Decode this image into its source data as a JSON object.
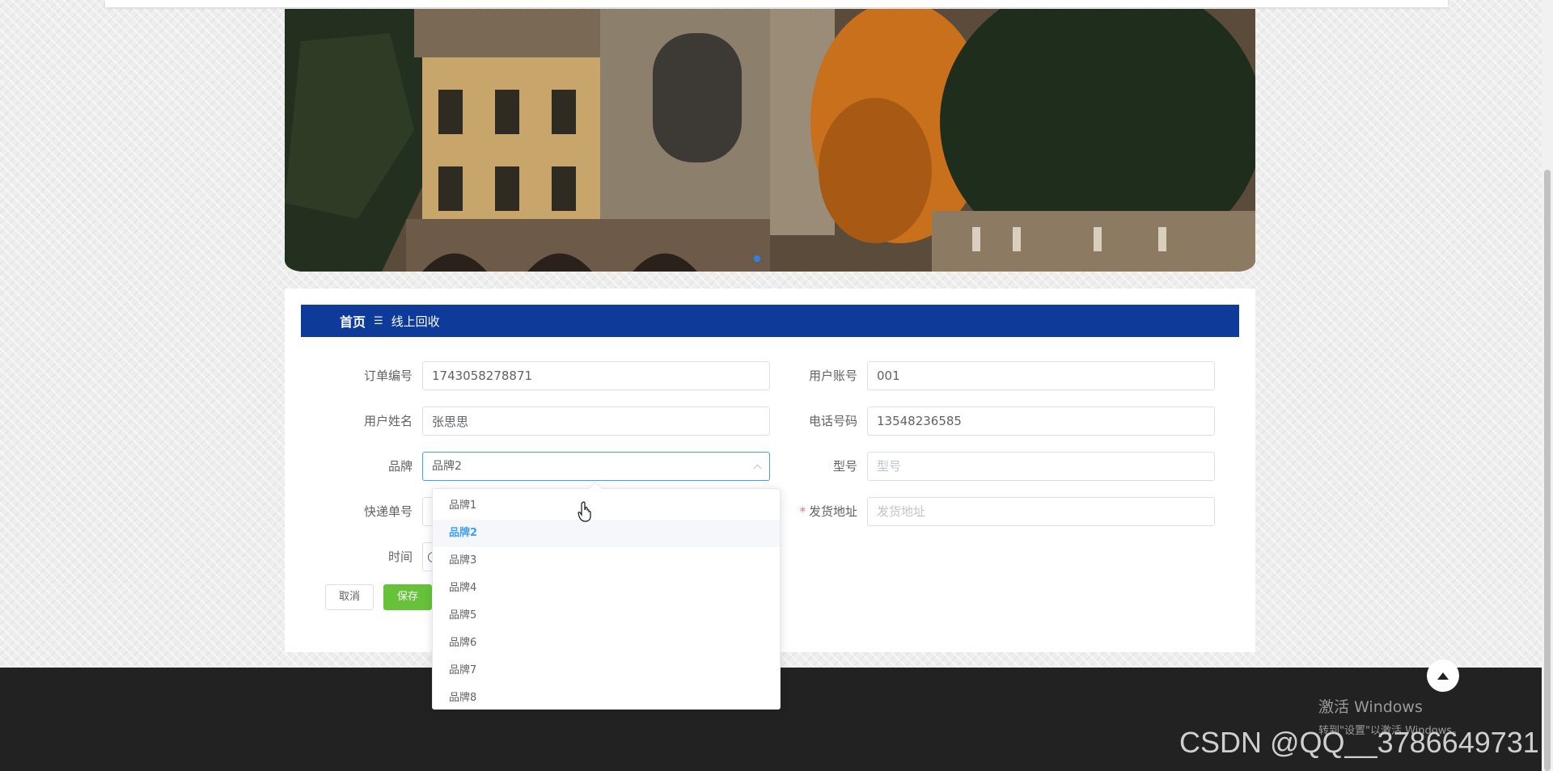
{
  "breadcrumb": {
    "home": "首页",
    "separator": "☰",
    "current": "线上回收"
  },
  "form": {
    "order_no": {
      "label": "订单编号",
      "value": "1743058278871"
    },
    "user_account": {
      "label": "用户账号",
      "value": "001"
    },
    "user_name": {
      "label": "用户姓名",
      "value": "张思思"
    },
    "phone": {
      "label": "电话号码",
      "value": "13548236585"
    },
    "brand": {
      "label": "品牌",
      "value": "品牌2"
    },
    "model": {
      "label": "型号",
      "placeholder": "型号"
    },
    "tracking_no": {
      "label": "快递单号"
    },
    "ship_address": {
      "label": "发货地址",
      "required_mark": "*",
      "placeholder": "发货地址"
    },
    "time": {
      "label": "时间"
    }
  },
  "buttons": {
    "cancel": "取消",
    "save": "保存"
  },
  "brand_dropdown": {
    "options": [
      "品牌1",
      "品牌2",
      "品牌3",
      "品牌4",
      "品牌5",
      "品牌6",
      "品牌7",
      "品牌8"
    ],
    "selected": "品牌2"
  },
  "overlay": {
    "activate_title": "激活 Windows",
    "activate_hint": "转到\"设置\"以激活 Windows。",
    "watermark": "CSDN @QQ__3786649731"
  },
  "colors": {
    "breadcrumb_bg": "#0e3a9a",
    "save_green": "#67c23a",
    "selected_blue": "#409eff",
    "footer": "#222222"
  },
  "icons": [
    "chevron-up-icon",
    "clock-icon",
    "arrow-up-icon",
    "hand-cursor-icon"
  ]
}
